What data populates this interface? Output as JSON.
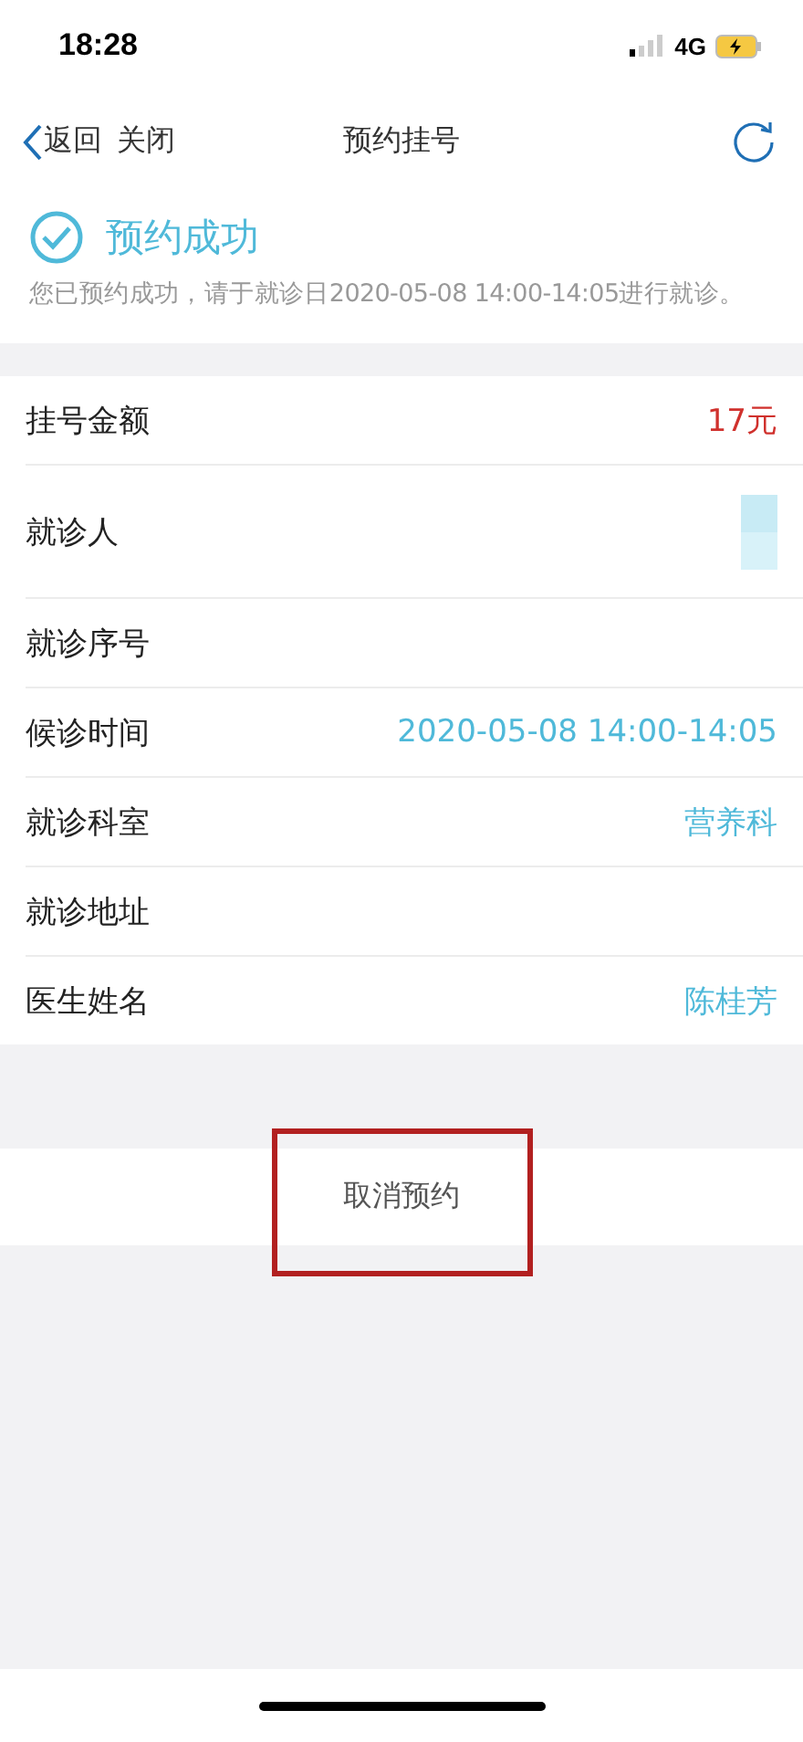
{
  "status_bar": {
    "time": "18:28",
    "network": "4G"
  },
  "nav": {
    "back": "返回",
    "close": "关闭",
    "title": "预约挂号"
  },
  "result": {
    "title": "预约成功",
    "message": "您已预约成功，请于就诊日2020-05-08 14:00-14:05进行就诊。"
  },
  "rows": [
    {
      "label": "挂号金额",
      "value": "17元",
      "kind": "price"
    },
    {
      "label": "就诊人",
      "kind": "redacted"
    },
    {
      "label": "就诊序号",
      "kind": "empty"
    },
    {
      "label": "候诊时间",
      "value": "2020-05-08 14:00-14:05",
      "kind": "info"
    },
    {
      "label": "就诊科室",
      "value": "营养科",
      "kind": "info"
    },
    {
      "label": "就诊地址",
      "kind": "empty"
    },
    {
      "label": "医生姓名",
      "value": "陈桂芳",
      "kind": "info"
    }
  ],
  "cancel_button": {
    "label": "取消预约",
    "highlighted": true
  }
}
